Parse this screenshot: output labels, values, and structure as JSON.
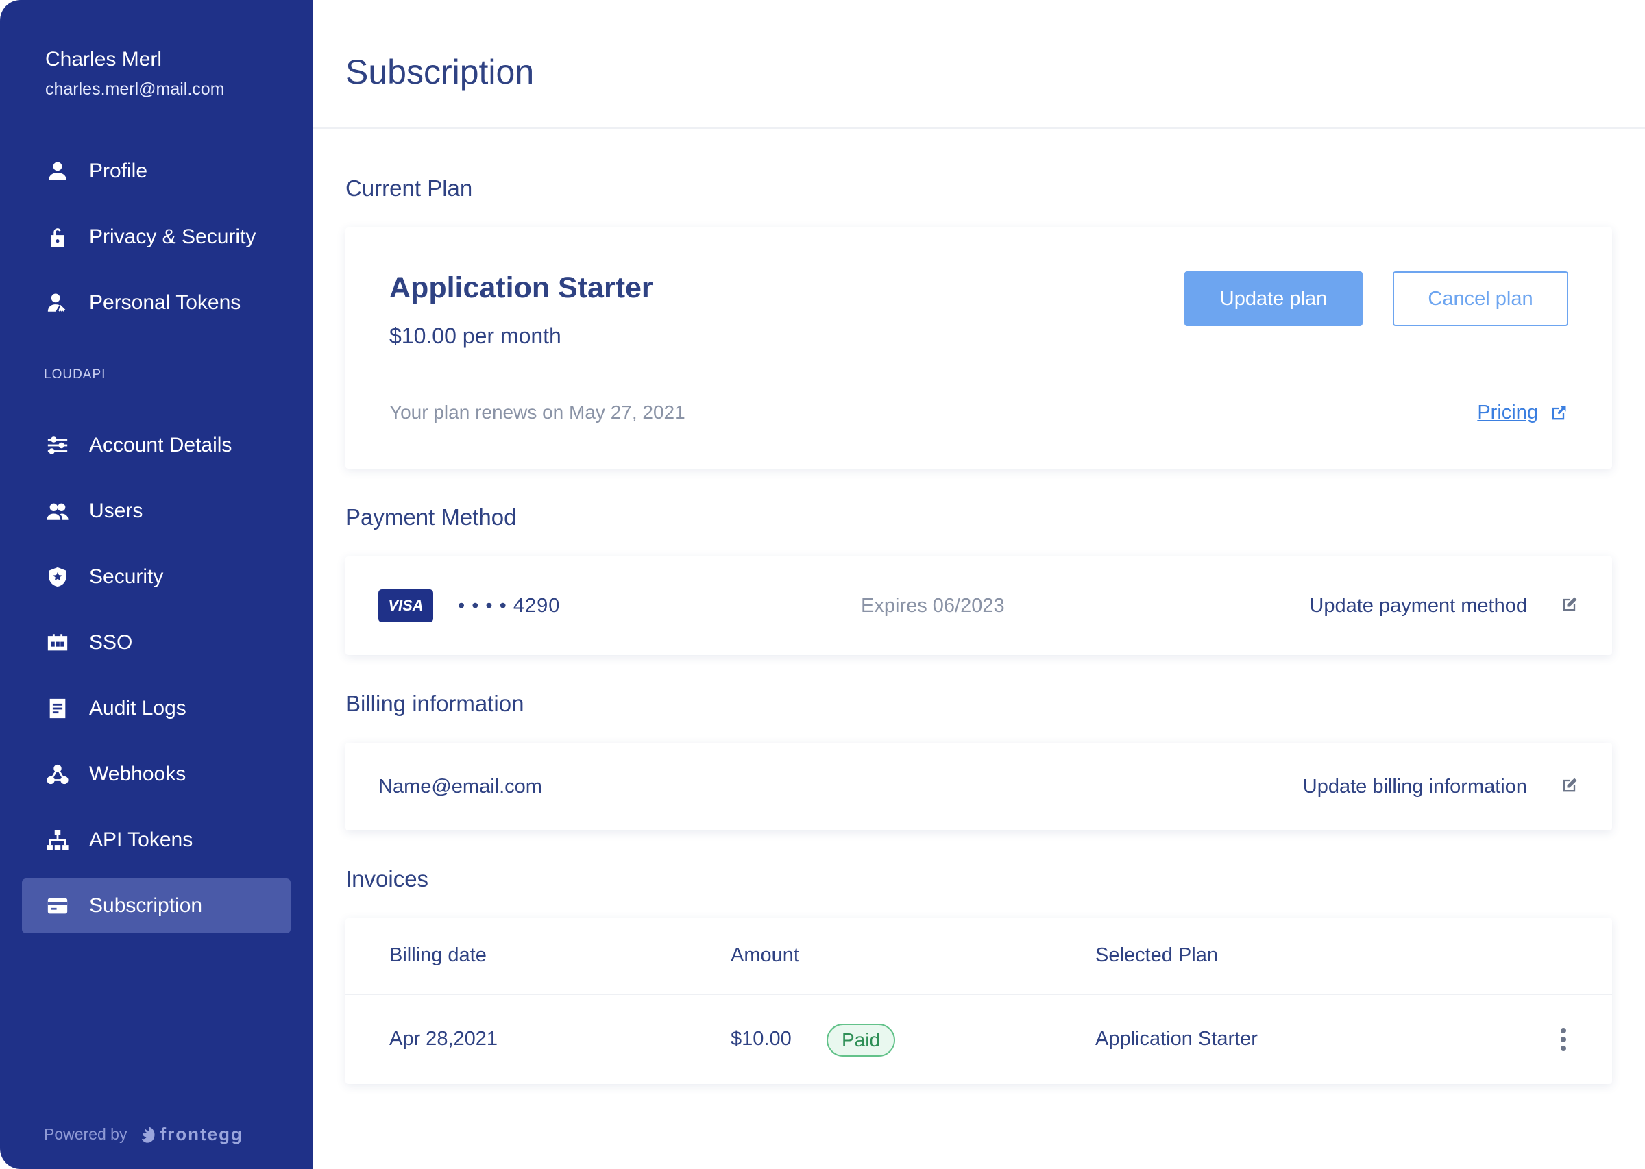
{
  "user": {
    "name": "Charles Merl",
    "email": "charles.merl@mail.com"
  },
  "sidebar": {
    "items_top": [
      {
        "label": "Profile",
        "icon": "person-icon"
      },
      {
        "label": "Privacy & Security",
        "icon": "lock-open-icon"
      },
      {
        "label": "Personal Tokens",
        "icon": "person-key-icon"
      }
    ],
    "section_label": "LOUDAPI",
    "items_bottom": [
      {
        "label": "Account Details",
        "icon": "sliders-icon"
      },
      {
        "label": "Users",
        "icon": "users-icon"
      },
      {
        "label": "Security",
        "icon": "shield-icon"
      },
      {
        "label": "SSO",
        "icon": "sso-icon"
      },
      {
        "label": "Audit Logs",
        "icon": "document-icon"
      },
      {
        "label": "Webhooks",
        "icon": "webhook-icon"
      },
      {
        "label": "API Tokens",
        "icon": "hierarchy-icon"
      },
      {
        "label": "Subscription",
        "icon": "card-icon",
        "active": true
      }
    ],
    "powered_by": "Powered by",
    "brand": "frontegg"
  },
  "page": {
    "title": "Subscription"
  },
  "current_plan": {
    "section_title": "Current Plan",
    "plan_name": "Application Starter",
    "price": "$10.00 per month",
    "renewal": "Your plan renews on May 27, 2021",
    "update_label": "Update plan",
    "cancel_label": "Cancel plan",
    "pricing_label": "Pricing"
  },
  "payment_method": {
    "section_title": "Payment Method",
    "card_brand": "VISA",
    "card_number": "• • • • 4290",
    "expiry": "Expires 06/2023",
    "action_label": "Update payment method"
  },
  "billing": {
    "section_title": "Billing information",
    "email": "Name@email.com",
    "action_label": "Update billing information"
  },
  "invoices": {
    "section_title": "Invoices",
    "columns": [
      "Billing date",
      "Amount",
      "Selected Plan"
    ],
    "rows": [
      {
        "date": "Apr 28,2021",
        "amount": "$10.00",
        "status": "Paid",
        "plan": "Application Starter"
      }
    ]
  },
  "colors": {
    "sidebar_bg": "#1f3188",
    "sidebar_active": "#4a5aa8",
    "primary_text": "#2f4283",
    "button_primary": "#6da5f0",
    "link": "#3b7fe0",
    "paid_green": "#2e8f56"
  }
}
